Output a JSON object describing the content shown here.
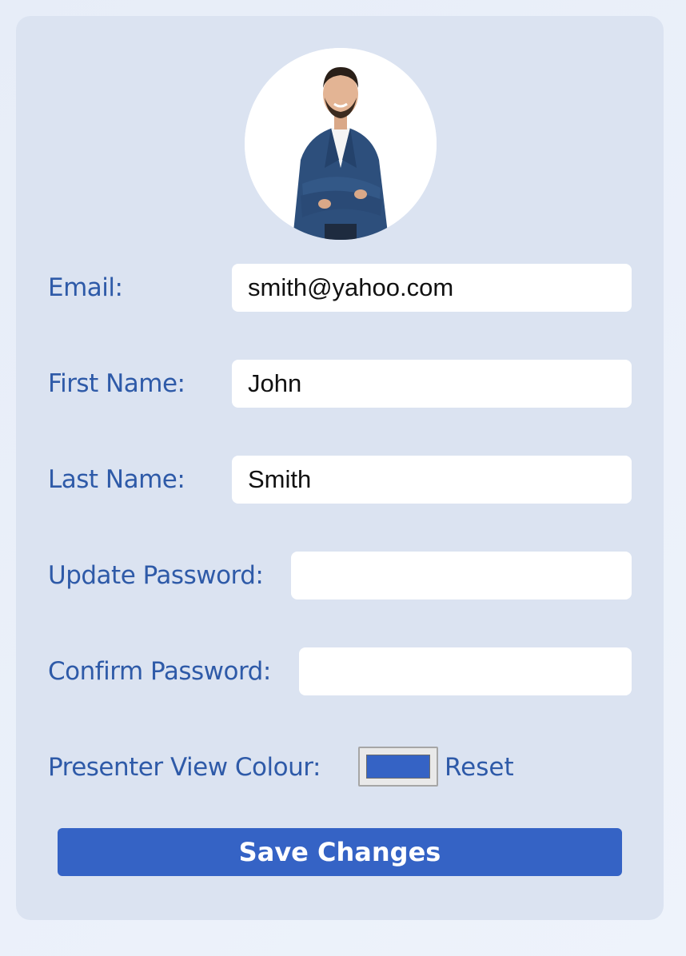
{
  "avatar": {
    "icon": "user-photo"
  },
  "fields": {
    "email": {
      "label": "Email:",
      "value": "smith@yahoo.com"
    },
    "first_name": {
      "label": "First Name:",
      "value": "John"
    },
    "last_name": {
      "label": "Last Name:",
      "value": "Smith"
    },
    "update_password": {
      "label": "Update Password:",
      "value": ""
    },
    "confirm_password": {
      "label": "Confirm Password:",
      "value": ""
    }
  },
  "presenter_colour": {
    "label": "Presenter View Colour:",
    "value": "#3563c5",
    "reset_label": "Reset"
  },
  "save_button": {
    "label": "Save Changes",
    "color": "#3563c5"
  },
  "theme": {
    "label_color": "#2e5aa8",
    "card_background": "#dbe3f1"
  }
}
